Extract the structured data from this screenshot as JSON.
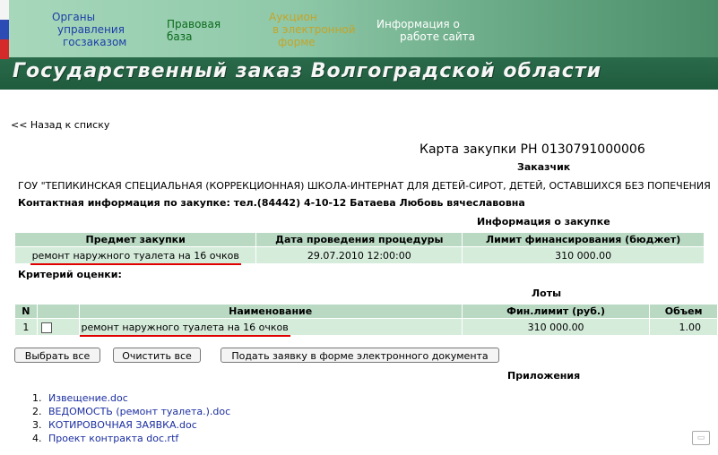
{
  "header": {
    "nav": [
      {
        "lines": [
          "Органы",
          "управления",
          "госзаказом"
        ]
      },
      {
        "lines": [
          "Правовая",
          "база"
        ]
      },
      {
        "lines": [
          "Аукцион",
          "в электронной",
          "форме"
        ]
      },
      {
        "lines": [
          "Информация о",
          "работе сайта"
        ]
      }
    ],
    "title": "Государственный заказ Волгоградской области"
  },
  "back_link": "<< Назад к списку",
  "card_title": "Карта закупки РН 0130791000006",
  "customer": {
    "heading": "Заказчик",
    "name": "ГОУ \"ТЕПИКИНСКАЯ СПЕЦИАЛЬНАЯ (КОРРЕКЦИОННАЯ) ШКОЛА-ИНТЕРНАТ ДЛЯ ДЕТЕЙ-СИРОТ, ДЕТЕЙ, ОСТАВШИХСЯ БЕЗ ПОПЕЧЕНИЯ"
  },
  "contact": "Контактная информация по закупке: тел.(84442) 4-10-12 Батаева Любовь вячеславовна",
  "purchase_info": {
    "heading": "Информация о закупке",
    "columns": [
      "Предмет закупки",
      "Дата проведения процедуры",
      "Лимит финансирования (бюджет)"
    ],
    "row": [
      "ремонт наружного туалета на 16 очков",
      "29.07.2010 12:00:00",
      "310 000.00"
    ]
  },
  "criteria_label": "Критерий оценки:",
  "lots": {
    "heading": "Лоты",
    "columns": [
      "N",
      "",
      "Наименование",
      "Фин.лимит (руб.)",
      "Объем"
    ],
    "row": {
      "n": "1",
      "name": "ремонт наружного туалета на 16 очков",
      "limit": "310 000.00",
      "volume": "1.00"
    }
  },
  "buttons": {
    "select_all": "Выбрать все",
    "clear_all": "Очистить все",
    "submit": "Подать заявку в форме электронного документа"
  },
  "attachments": {
    "heading": "Приложения",
    "items": [
      "Извещение.doc",
      "ВЕДОМОСТЬ (ремонт туалета.).doc",
      "КОТИРОВОЧНАЯ ЗАЯВКА.doc",
      "Проект контракта doc.rtf"
    ]
  },
  "colors": {
    "header_cell": "#b9d9c3",
    "body_cell": "#d6ecdb",
    "underline": "#e00000",
    "link": "#1b2ea0"
  }
}
